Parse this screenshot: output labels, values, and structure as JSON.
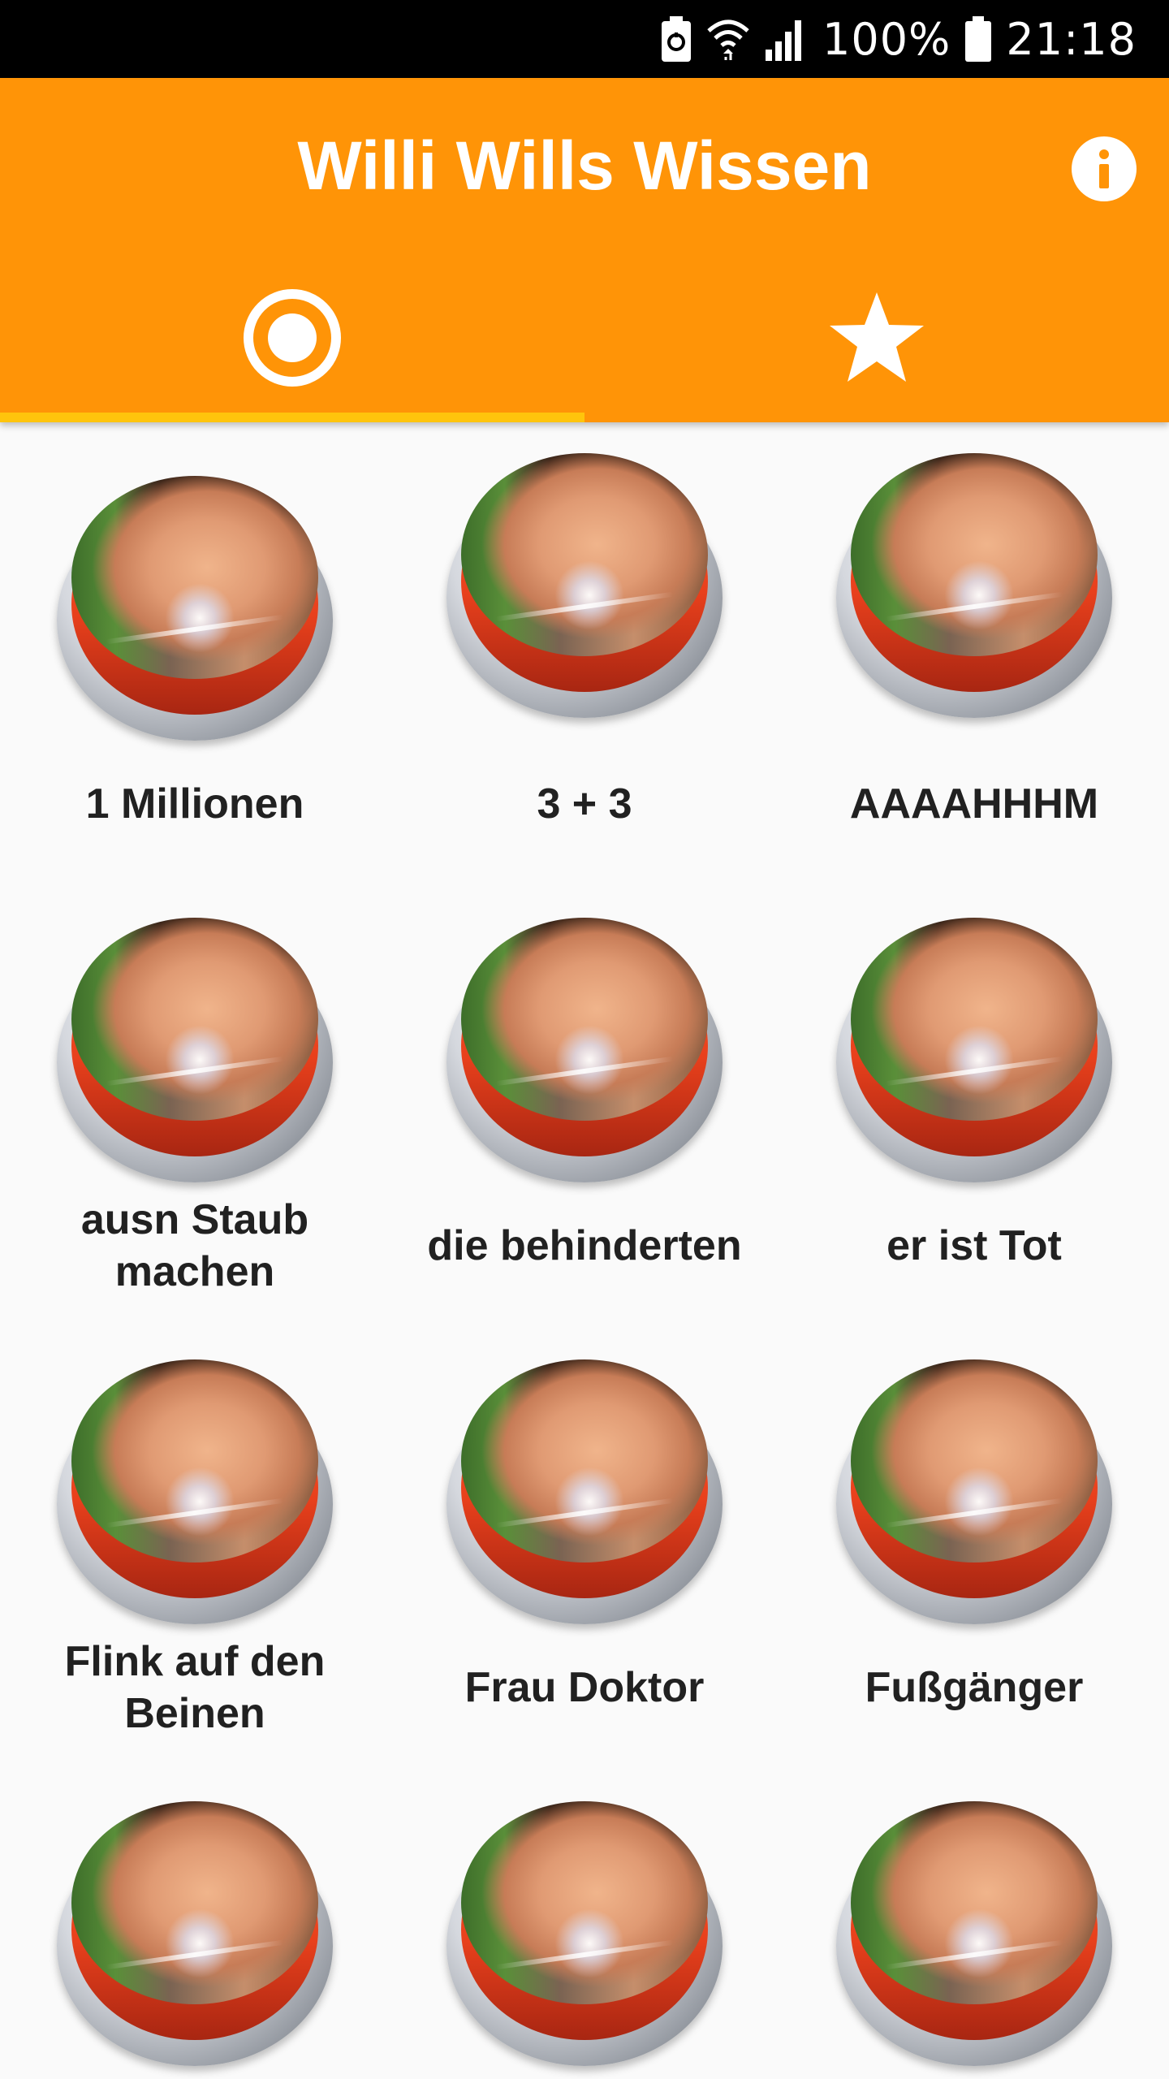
{
  "status_bar": {
    "battery_percent": "100%",
    "time": "21:18"
  },
  "app_bar": {
    "title": "Willi Wills Wissen",
    "info_icon": "info-icon",
    "background_color": "#ff9407"
  },
  "tabs": [
    {
      "name": "sounds",
      "icon": "radio-button-icon",
      "selected": true
    },
    {
      "name": "favorites",
      "icon": "star-icon",
      "selected": false
    }
  ],
  "tab_indicator_color": "#ffc40c",
  "sound_buttons": [
    {
      "label": "1 Millionen"
    },
    {
      "label": "3 + 3"
    },
    {
      "label": "AAAAHHHM"
    },
    {
      "label": "ausn Staub machen"
    },
    {
      "label": "die behinderten"
    },
    {
      "label": "er ist Tot"
    },
    {
      "label": "Flink auf den Beinen"
    },
    {
      "label": "Frau Doktor"
    },
    {
      "label": "Fußgänger"
    },
    {
      "label": ""
    },
    {
      "label": ""
    },
    {
      "label": ""
    }
  ]
}
